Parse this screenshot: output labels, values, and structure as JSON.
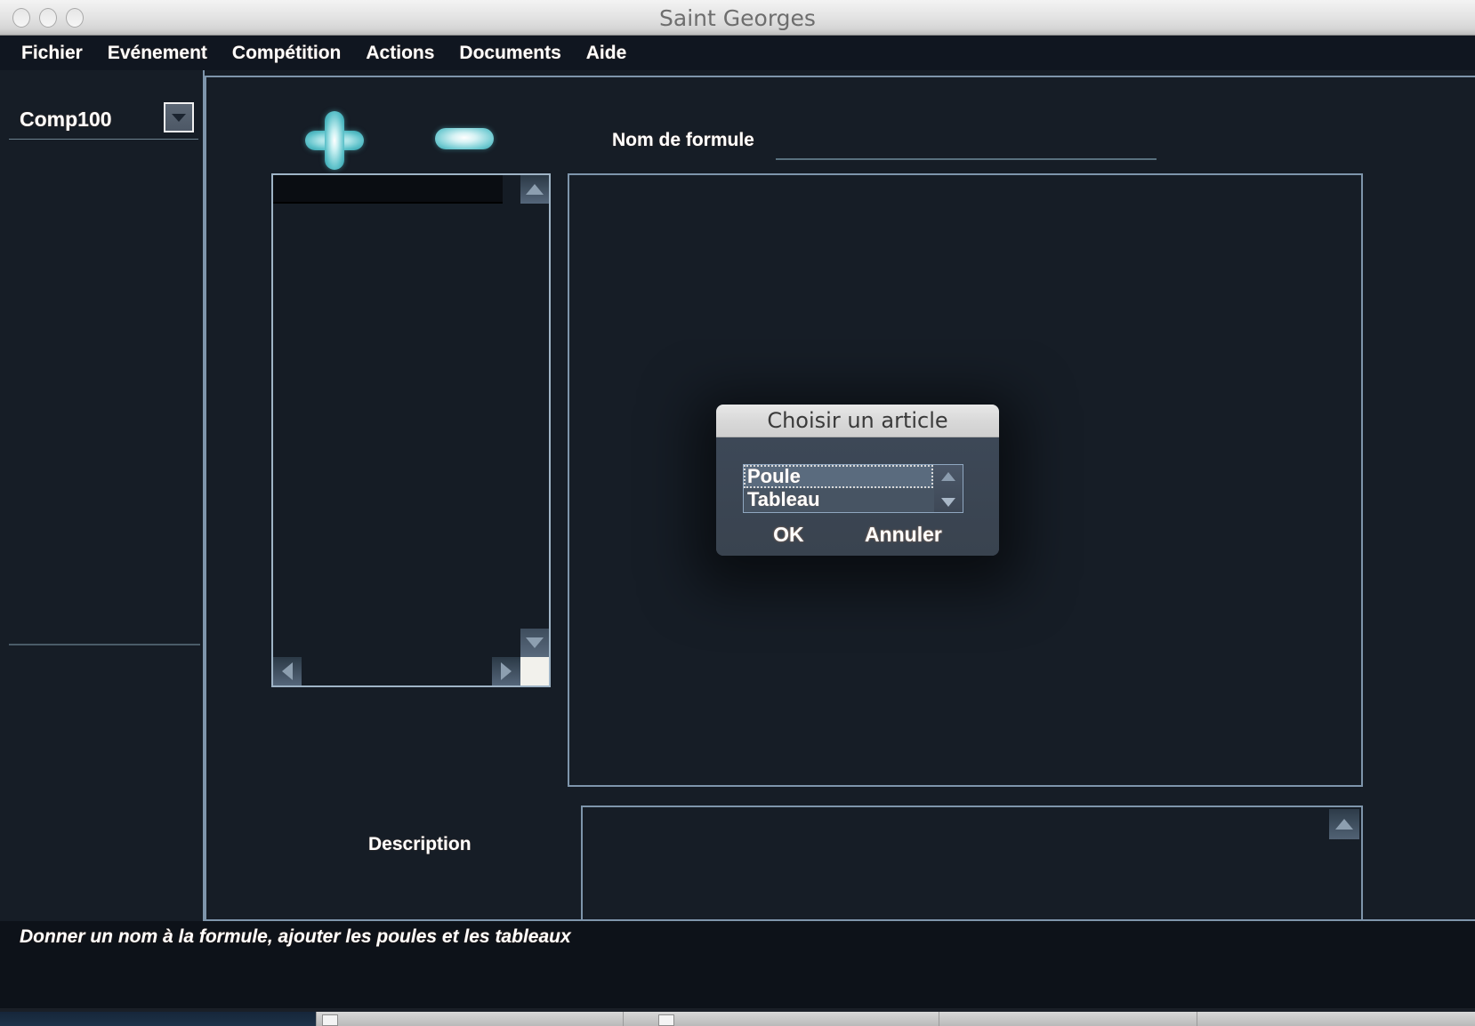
{
  "window": {
    "title": "Saint Georges",
    "controls": [
      "close",
      "minimize",
      "zoom"
    ]
  },
  "menu": {
    "items": [
      {
        "label": "Fichier"
      },
      {
        "label": "Evénement"
      },
      {
        "label": "Compétition"
      },
      {
        "label": "Actions"
      },
      {
        "label": "Documents"
      },
      {
        "label": "Aide"
      }
    ]
  },
  "sidebar": {
    "combo": {
      "value": "Comp100",
      "icon": "chevron-down-icon"
    }
  },
  "toolbar": {
    "add_label": "+",
    "remove_label": "-"
  },
  "form": {
    "nom_formule_label": "Nom de formule",
    "nom_formule_value": "",
    "description_label": "Description",
    "description_value": ""
  },
  "list": {
    "items": [],
    "scroll_icons": {
      "up": "arrow-up-icon",
      "down": "arrow-down-icon",
      "left": "arrow-left-icon",
      "right": "arrow-right-icon"
    }
  },
  "dialog": {
    "title": "Choisir un article",
    "options": [
      {
        "label": "Poule",
        "selected": true
      },
      {
        "label": "Tableau",
        "selected": false
      }
    ],
    "ok_label": "OK",
    "cancel_label": "Annuler"
  },
  "status": {
    "message": "Donner un nom à la formule, ajouter les poules et les tableaux"
  },
  "colors": {
    "app_background": "#161d26",
    "panel_border": "#7e95ab",
    "menu_background": "#101620",
    "accent_teal": "#62c4cc",
    "status_background": "#0d1219",
    "dialog_body": "#3c4757"
  }
}
